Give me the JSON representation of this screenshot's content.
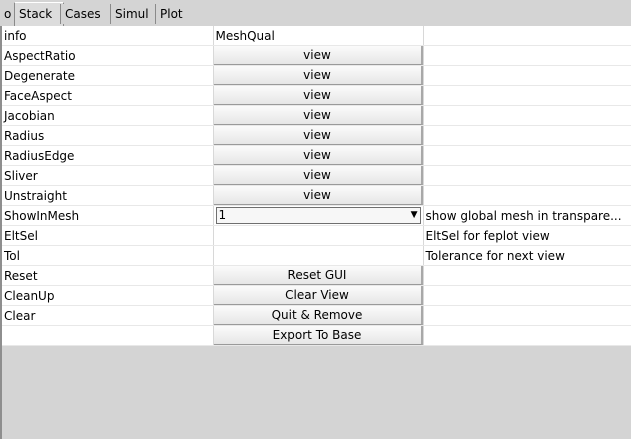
{
  "tabs": [
    {
      "label": "o"
    },
    {
      "label": "Stack"
    },
    {
      "label": "Cases"
    },
    {
      "label": "Simul"
    },
    {
      "label": "Plot"
    }
  ],
  "rows": [
    {
      "name": "info",
      "value": "MeshQual",
      "comment": ""
    },
    {
      "name": "AspectRatio",
      "button": "view",
      "comment": ""
    },
    {
      "name": "Degenerate",
      "button": "view",
      "comment": ""
    },
    {
      "name": "FaceAspect",
      "button": "view",
      "comment": ""
    },
    {
      "name": "Jacobian",
      "button": "view",
      "comment": ""
    },
    {
      "name": "Radius",
      "button": "view",
      "comment": ""
    },
    {
      "name": "RadiusEdge",
      "button": "view",
      "comment": ""
    },
    {
      "name": "Sliver",
      "button": "view",
      "comment": ""
    },
    {
      "name": "Unstraight",
      "button": "view",
      "comment": ""
    },
    {
      "name": "ShowInMesh",
      "select": "1",
      "comment": "show global mesh in transpare..."
    },
    {
      "name": "EltSel",
      "value": "",
      "comment": "EltSel for feplot view"
    },
    {
      "name": "Tol",
      "value": "",
      "comment": "Tolerance for next view"
    },
    {
      "name": "Reset",
      "button": "Reset GUI",
      "comment": ""
    },
    {
      "name": "CleanUp",
      "button": "Clear View",
      "comment": ""
    },
    {
      "name": "Clear",
      "button": "Quit & Remove",
      "comment": ""
    },
    {
      "name": "",
      "button": "Export To Base",
      "comment": ""
    }
  ]
}
